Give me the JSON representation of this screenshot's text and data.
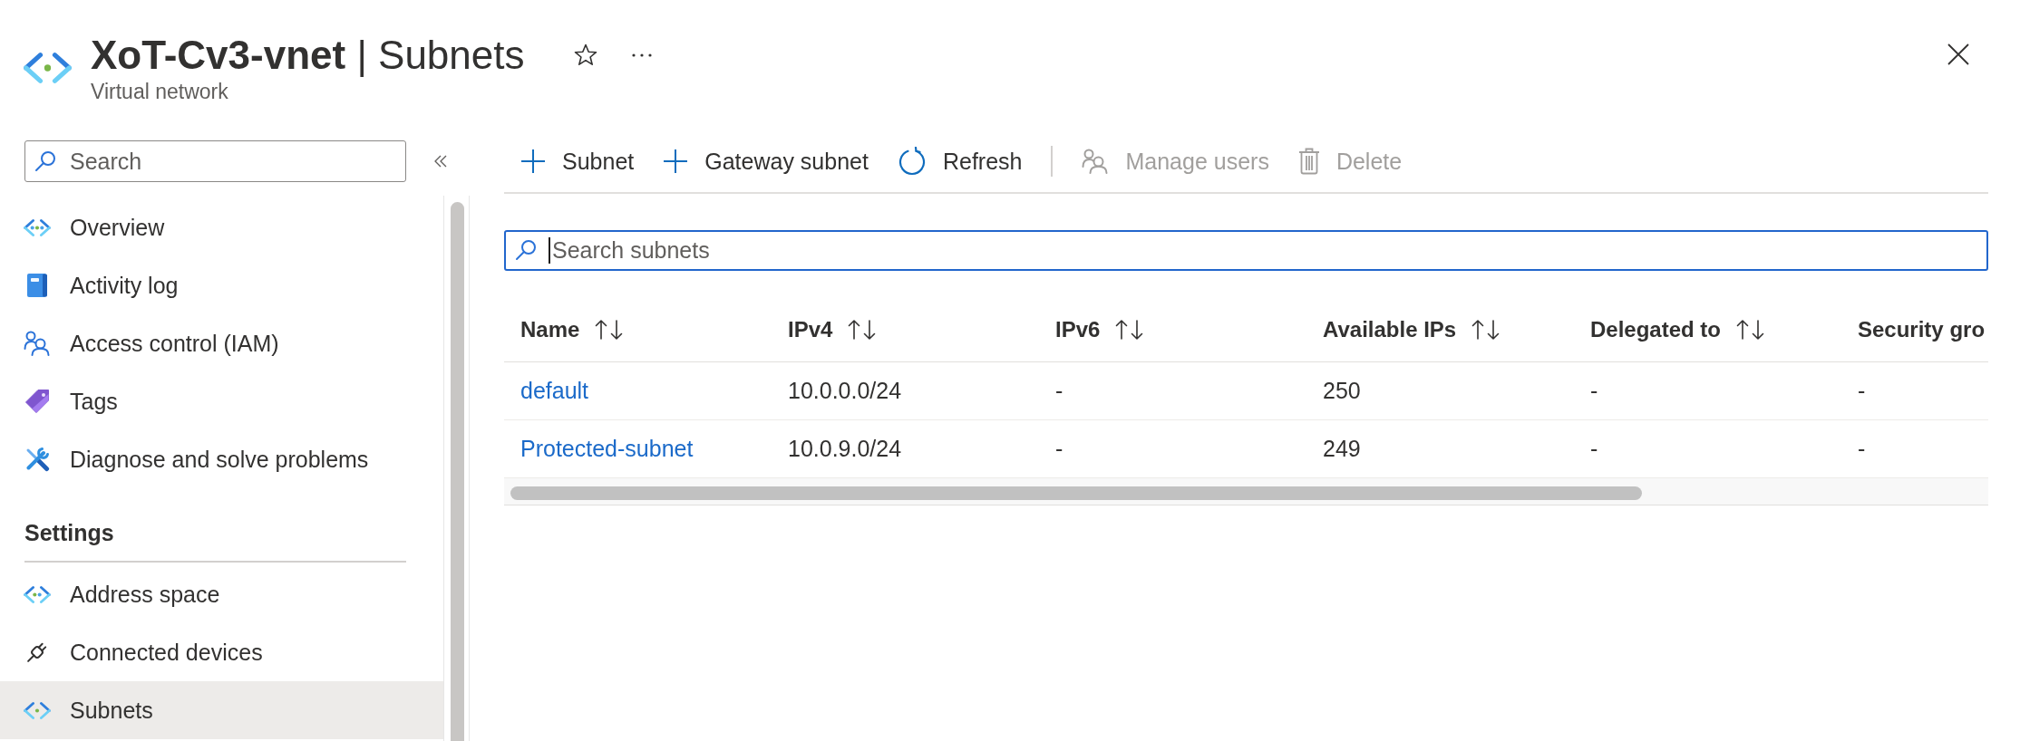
{
  "header": {
    "title": "**XoT-Cv3-vnet** | Subnets",
    "subtitle": "Virtual network"
  },
  "sidebar": {
    "search": {
      "placeholder": "Search"
    },
    "sections": [
      {
        "items": [
          {
            "label": "Overview",
            "selected": false
          },
          {
            "label": "Activity log",
            "selected": false
          },
          {
            "label": "Access control (IAM)",
            "selected": false
          },
          {
            "label": "Tags",
            "selected": false
          },
          {
            "label": "Diagnose and solve problems",
            "selected": false
          }
        ]
      },
      {
        "heading": "Settings",
        "items": [
          {
            "label": "Address space",
            "selected": false
          },
          {
            "label": "Connected devices",
            "selected": false
          },
          {
            "label": "Subnets",
            "selected": true
          }
        ]
      }
    ]
  },
  "toolbar": {
    "groups": [
      [
        {
          "label": "Subnet",
          "disabled": false
        },
        {
          "label": "Gateway subnet",
          "disabled": false
        },
        {
          "label": "Refresh",
          "disabled": false
        }
      ],
      [
        {
          "label": "Manage users",
          "disabled": true
        },
        {
          "label": "Delete",
          "disabled": true
        }
      ]
    ]
  },
  "search": {
    "placeholder": "Search subnets",
    "focused": true
  },
  "table": {
    "columns": [
      {
        "label": "Name",
        "sortable": true
      },
      {
        "label": "IPv4",
        "sortable": true
      },
      {
        "label": "IPv6",
        "sortable": true
      },
      {
        "label": "Available IPs",
        "sortable": true
      },
      {
        "label": "Delegated to",
        "sortable": true
      },
      {
        "label": "Security gro",
        "sortable": false
      }
    ],
    "rows": [
      {
        "cells": [
          "default",
          "10.0.0.0/24",
          "-",
          "250",
          "-",
          "-"
        ]
      },
      {
        "cells": [
          "Protected-subnet",
          "10.0.9.0/24",
          "-",
          "249",
          "-",
          "-"
        ]
      }
    ]
  }
}
